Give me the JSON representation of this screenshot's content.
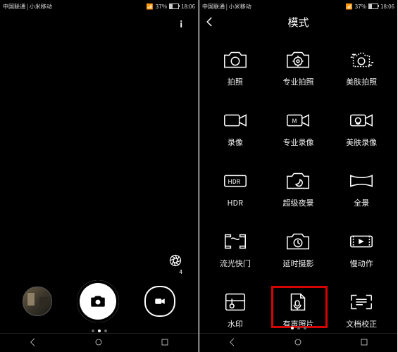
{
  "status": {
    "carrier": "中国联通 | 小米移动",
    "battery_pct": "37%",
    "time": "18:06"
  },
  "left_screen": {
    "info_label": "i",
    "aperture_value": "4",
    "page_dot_active_index": 1
  },
  "right_screen": {
    "title": "模式",
    "modes": [
      {
        "id": "photo",
        "label": "拍照"
      },
      {
        "id": "pro-photo",
        "label": "专业拍照"
      },
      {
        "id": "beauty-photo",
        "label": "美肤拍照"
      },
      {
        "id": "video",
        "label": "录像"
      },
      {
        "id": "pro-video",
        "label": "专业录像"
      },
      {
        "id": "beauty-video",
        "label": "美肤录像"
      },
      {
        "id": "hdr",
        "label": "HDR"
      },
      {
        "id": "night",
        "label": "超级夜景"
      },
      {
        "id": "panorama",
        "label": "全景"
      },
      {
        "id": "light",
        "label": "流光快门"
      },
      {
        "id": "timelapse",
        "label": "延时摄影"
      },
      {
        "id": "slowmo",
        "label": "慢动作"
      },
      {
        "id": "watermark",
        "label": "水印"
      },
      {
        "id": "audio-photo",
        "label": "有声照片"
      },
      {
        "id": "doc-scan",
        "label": "文档校正"
      }
    ],
    "highlighted_mode_index": 13,
    "page_dot_active_index": 0
  },
  "nav": {
    "items": [
      "back",
      "home",
      "recent"
    ]
  }
}
